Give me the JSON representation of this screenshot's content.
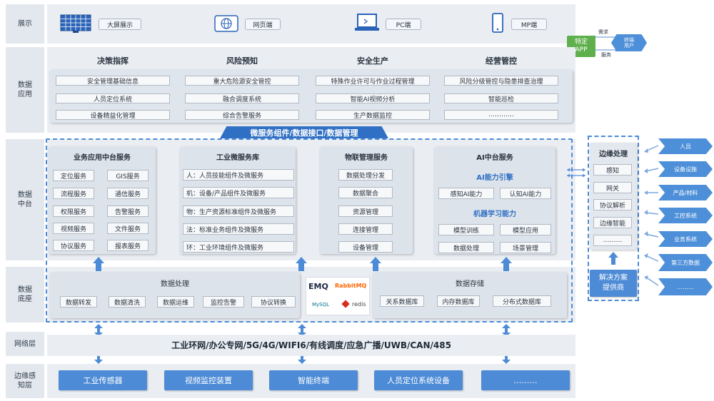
{
  "layers": {
    "display": "展示",
    "data_app": "数据\n应用",
    "data_middle": "数据\n中台",
    "data_base": "数据\n底座",
    "network": "网络层",
    "edge": "边缘感\n知层"
  },
  "display": {
    "items": [
      "大屏展示",
      "网页端",
      "PC端",
      "MP端"
    ],
    "icons": [
      "monitor-grid-icon",
      "globe-icon",
      "laptop-icon",
      "phone-icon"
    ]
  },
  "external": {
    "app": "特定\nAPP",
    "user": "终端\n用户",
    "request": "需求",
    "service": "服务"
  },
  "data_app": {
    "headers": [
      "决策指挥",
      "风险预知",
      "安全生产",
      "经营管控"
    ],
    "rows": [
      [
        "安全管理基础信息",
        "重大危险源安全管控",
        "特殊作业许可与作业过程管理",
        "风险分级管控与隐患排查治理"
      ],
      [
        "人员定位系统",
        "融合调度系统",
        "智能AI视频分析",
        "智能巡检"
      ],
      [
        "设备精益化管理",
        "综合告警服务",
        "生产数据监控",
        "…………"
      ]
    ]
  },
  "banner": "微服务组件/数据接口/数据管理",
  "middle": {
    "business": {
      "title": "业务应用中台服务",
      "items": [
        "定位服务",
        "GIS服务",
        "流程服务",
        "通信服务",
        "权限服务",
        "告警服务",
        "视频服务",
        "文件服务",
        "协议服务",
        "报表服务"
      ]
    },
    "industrial": {
      "title": "工业微服务库",
      "items": [
        "人：人员技能组件及微服务",
        "机：设备/产品组件及微服务",
        "物：生产资源标准组件及微服务",
        "法：标准业务组件及微服务",
        "环：工业环境组件及微服务"
      ]
    },
    "iot": {
      "title": "物联管理服务",
      "items": [
        "数据处理分发",
        "数据聚合",
        "资源管理",
        "连接管理",
        "设备管理"
      ]
    },
    "ai": {
      "title": "AI中台服务",
      "engine": "AI能力引擎",
      "engine_items": [
        "感知AI能力",
        "认知AI能力"
      ],
      "ml": "机器学习能力",
      "ml_items": [
        "模型训练",
        "模型应用",
        "数据处理",
        "场景管理"
      ]
    }
  },
  "base": {
    "processing": {
      "title": "数据处理",
      "items": [
        "数据转发",
        "数据清洗",
        "数据运维",
        "监控告警",
        "协议转换"
      ]
    },
    "logos": [
      "EMQ",
      "RabbitMQ",
      "MySQL",
      "redis"
    ],
    "storage": {
      "title": "数据存储",
      "items": [
        "关系数据库",
        "内存数据库",
        "分布式数据库"
      ]
    }
  },
  "edge_processing": {
    "title": "边缘处理",
    "items": [
      "感知",
      "网关",
      "协议解析",
      "边缘智能",
      "………"
    ],
    "provider": "解决方案\n提供商"
  },
  "sources": [
    "人员",
    "设备设施",
    "产品/材料",
    "工控系统",
    "业务系统",
    "第三方数据",
    "………"
  ],
  "network": "工业环网/办公专网/5G/4G/WIFI6/有线调度/应急广播/UWB/CAN/485",
  "edge_layer": [
    "工业传感器",
    "视频监控装置",
    "智能终端",
    "人员定位系统设备",
    "………"
  ],
  "colors": {
    "accent": "#4d8bd6",
    "banner": "#2f6fc4",
    "band": "#eaeef3",
    "panel": "#dde3ea"
  }
}
